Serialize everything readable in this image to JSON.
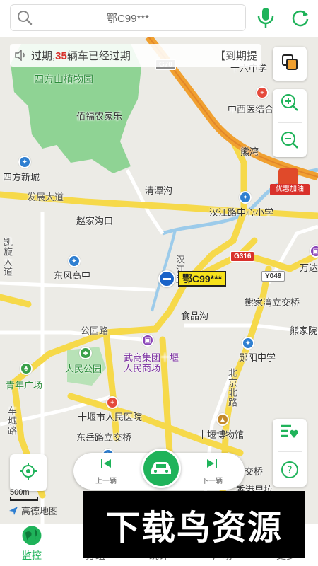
{
  "search": {
    "plate_query": "鄂C99***",
    "icon": "search-icon"
  },
  "toolbar": {
    "mic_icon": "mic-icon",
    "refresh_icon": "refresh-icon"
  },
  "notice": {
    "prefix": "过期,",
    "count": "35",
    "suffix": "辆车已经过期",
    "right_text": "【到期提",
    "icon": "speaker-icon"
  },
  "map": {
    "labels": {
      "botanical_garden": "四方山植物园",
      "farm": "佰福农家乐",
      "sifang_new_city": "四方新城",
      "fazhan_road": "发展大道",
      "qingtan": "清潭沟",
      "zhaojia": "赵家沟口",
      "kaixuan": "凯旋大道",
      "dongfeng_school": "东风高中",
      "gongyuan_road": "公园路",
      "people_park": "人民公园",
      "youth_square": "青年广场",
      "wushang": "武商集团十堰人民商场",
      "shipinggou": "食品沟",
      "hanjiang_road": "汉江路",
      "hanjiang_school": "汉江路中心小学",
      "xiongjiawan": "熊家湾立交桥",
      "xiongjiayuan": "熊家院",
      "yunyang_school": "郧阳中学",
      "beijing_road": "北京北路",
      "shiyan_hospital": "十堰市人民医院",
      "dongyue": "东岳路立交桥",
      "museum": "十堰博物馆",
      "wanda": "万达",
      "chinese_hospital": "中西医结合",
      "school16": "十六中学",
      "chewan": "车城",
      "xiangjia": "熊湾",
      "chechenglu": "车城路",
      "jiaoqiao": "交桥",
      "xianggang": "香港里拉"
    },
    "shields": {
      "g70": "G70",
      "g316": "G316",
      "y049": "Y049"
    },
    "promo": "优惠加油"
  },
  "vehicle": {
    "plate": "鄂C99***"
  },
  "controls": {
    "layers_icon": "layers-icon",
    "zoom_in_icon": "zoom-in-icon",
    "zoom_out_icon": "zoom-out-icon",
    "car_list_icon": "car-list-icon",
    "help_icon": "help-icon",
    "locate_icon": "locate-icon"
  },
  "switcher": {
    "prev_label": "上一辆",
    "next_label": "下一辆"
  },
  "scale": {
    "label": "500m"
  },
  "amap_logo": "高德地图",
  "nav": {
    "tabs": [
      {
        "label": "监控",
        "active": true
      },
      {
        "label": "分组"
      },
      {
        "label": "统计"
      },
      {
        "label": "广场"
      },
      {
        "label": "更多"
      }
    ]
  },
  "watermark": "下载鸟资源",
  "colors": {
    "accent": "#1fb35a",
    "plate_bg": "#f7e11b",
    "alert_red": "#d9312b"
  }
}
